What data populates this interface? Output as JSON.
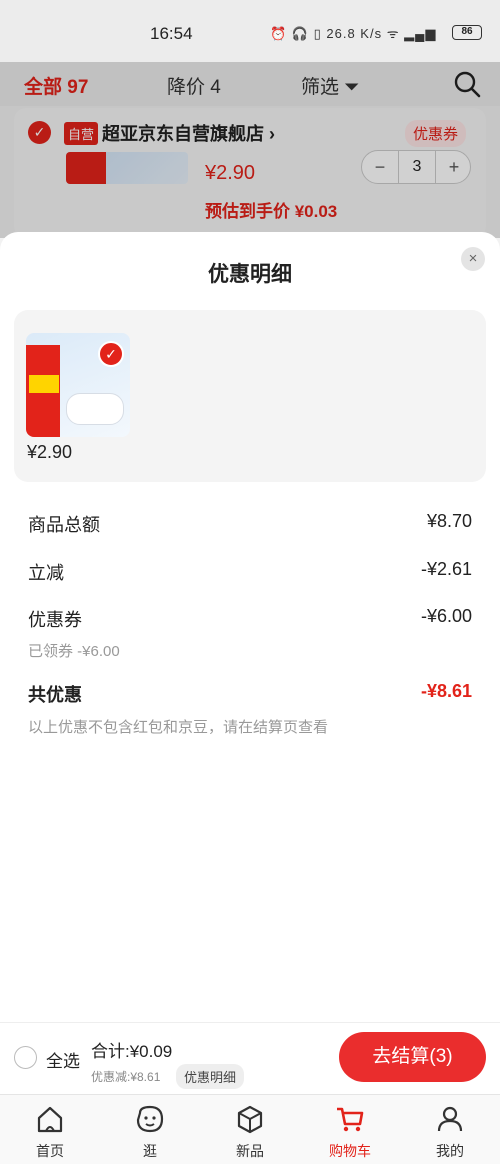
{
  "status": {
    "time": "16:54",
    "net_speed": "26.8 K/s",
    "battery": "86"
  },
  "top": {
    "all": "全部 97",
    "price_drop": "降价 4",
    "filter": "筛选"
  },
  "cart_item": {
    "badge": "自营",
    "shop": "超亚京东自营旗舰店 ›",
    "coupon": "优惠券",
    "price": "¥2.90",
    "quantity": "3",
    "minus": "−",
    "plus": "+",
    "estimate": "预估到手价 ¥0.03"
  },
  "sheet": {
    "title": "优惠明细",
    "close": "×",
    "product_price": "¥2.90",
    "rows": [
      {
        "label": "商品总额",
        "value": "¥8.70"
      },
      {
        "label": "立减",
        "value": "-¥2.61"
      },
      {
        "label": "优惠券",
        "value": "-¥6.00",
        "sub": "已领券 -¥6.00"
      },
      {
        "label": "共优惠",
        "value": "-¥8.61"
      }
    ],
    "note": "以上优惠不包含红包和京豆，请在结算页查看"
  },
  "bottom": {
    "select_all": "全选",
    "total": "合计:¥0.09",
    "discount": "优惠减:¥8.61",
    "detail": "优惠明细",
    "checkout": "去结算(3)"
  },
  "nav": [
    {
      "label": "首页",
      "icon": "home-icon"
    },
    {
      "label": "逛",
      "icon": "smile-face-icon"
    },
    {
      "label": "新品",
      "icon": "cube-icon"
    },
    {
      "label": "购物车",
      "icon": "cart-icon"
    },
    {
      "label": "我的",
      "icon": "user-icon"
    }
  ],
  "colors": {
    "accent": "#e2231a"
  }
}
